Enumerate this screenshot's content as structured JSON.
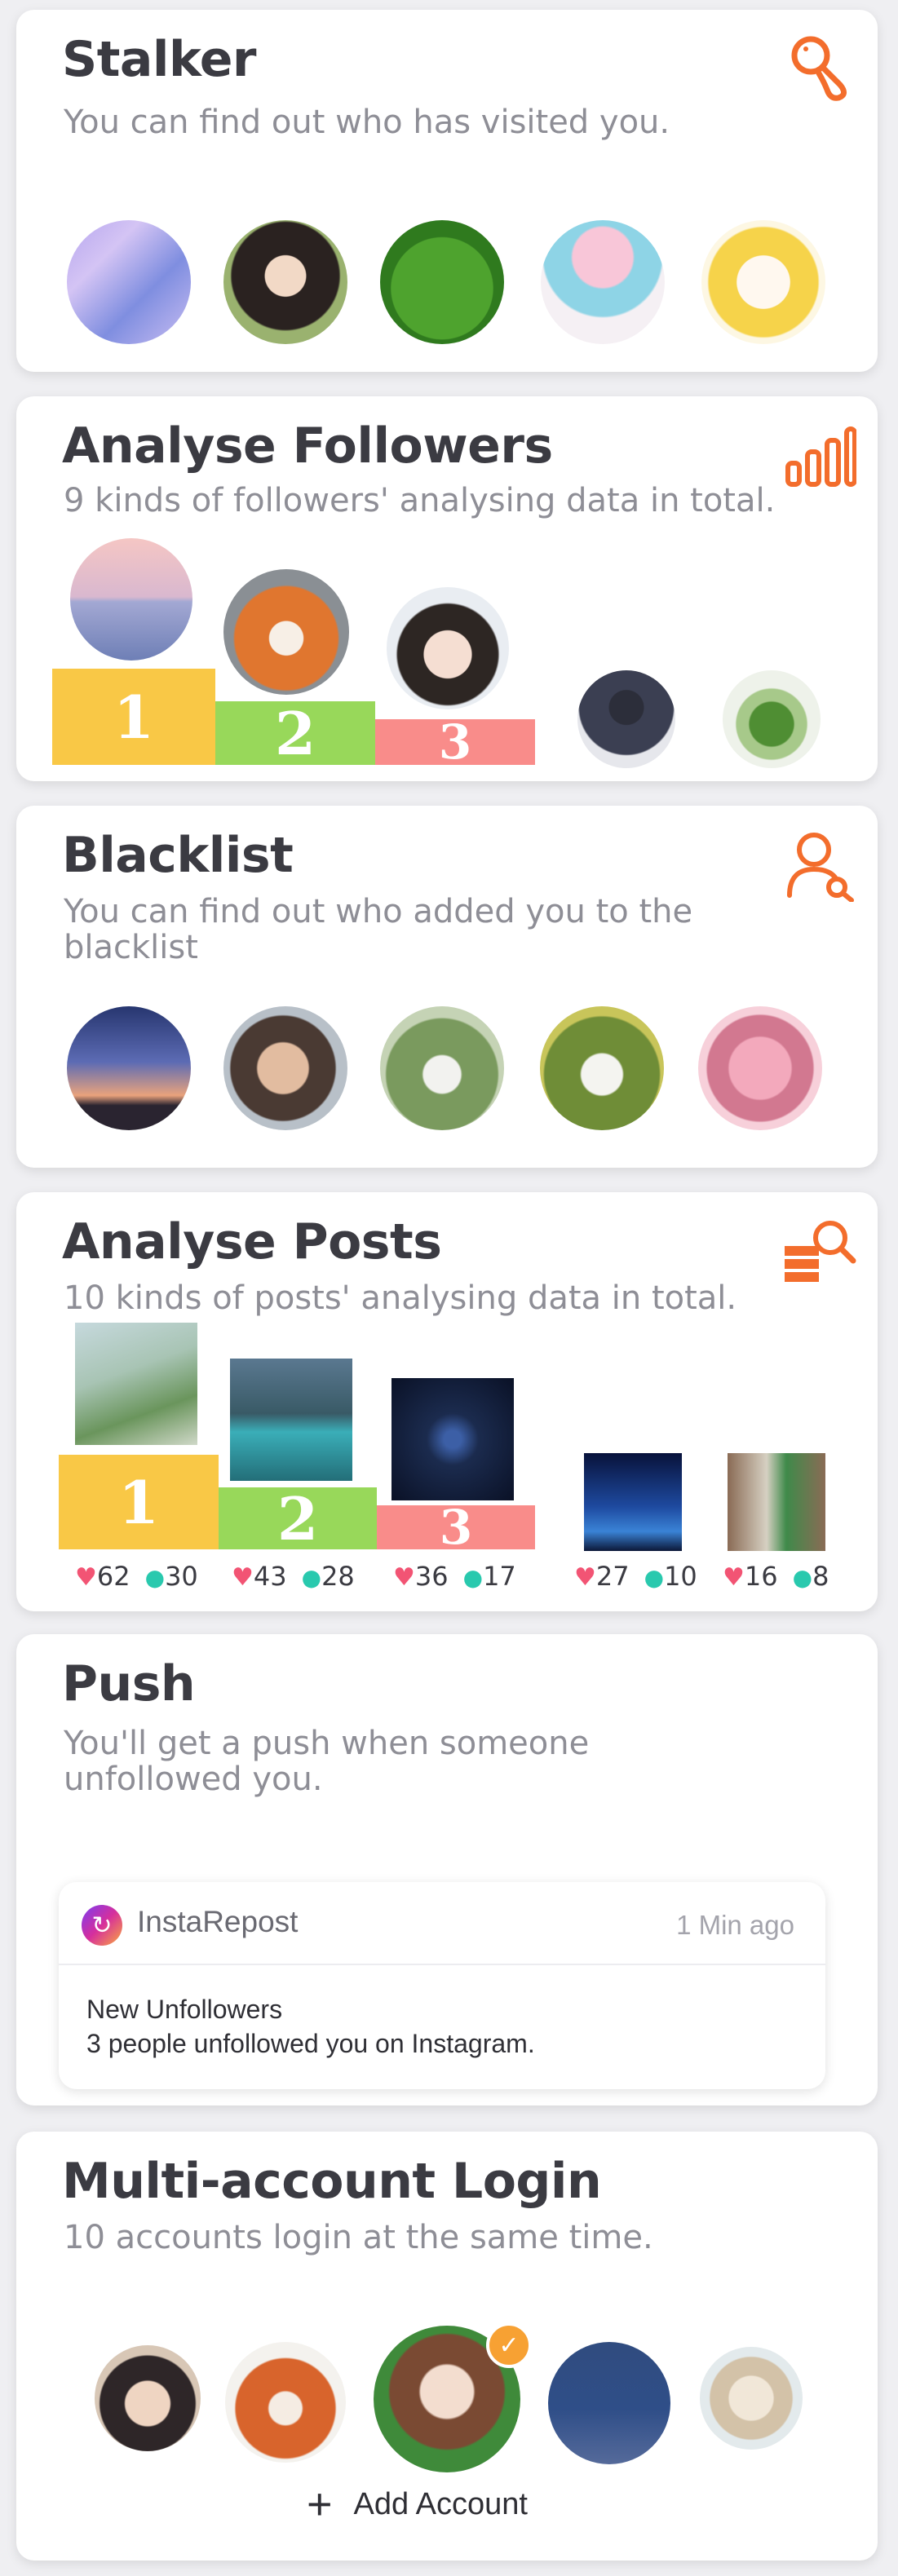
{
  "stalker": {
    "title": "Stalker",
    "subtitle": "You can find out who has visited you.",
    "icon": "footprint-search-icon"
  },
  "followers": {
    "title": "Analyse Followers",
    "subtitle": "9 kinds of followers' analysing data in total.",
    "icon": "bar-chart-icon",
    "ranks": [
      "1",
      "2",
      "3"
    ]
  },
  "blacklist": {
    "title": "Blacklist",
    "subtitle_line1": "You can find out who added you to the",
    "subtitle_line2": "blacklist",
    "icon": "user-search-icon"
  },
  "posts": {
    "title": "Analyse Posts",
    "subtitle": "10 kinds of posts' analysing data in total.",
    "icon": "stack-search-icon",
    "ranks": [
      "1",
      "2",
      "3"
    ],
    "stats": [
      {
        "likes": "62",
        "comments": "30"
      },
      {
        "likes": "43",
        "comments": "28"
      },
      {
        "likes": "36",
        "comments": "17"
      },
      {
        "likes": "27",
        "comments": "10"
      },
      {
        "likes": "16",
        "comments": "8"
      }
    ]
  },
  "push": {
    "title": "Push",
    "subtitle_line1": "You'll get a push when someone",
    "subtitle_line2": "unfollowed you.",
    "notification": {
      "app_name": "InstaRepost",
      "time": "1 Min ago",
      "heading": "New Unfollowers",
      "body": "3 people unfollowed you on Instagram."
    }
  },
  "multi": {
    "title": "Multi-account Login",
    "subtitle": "10 accounts login at the same time.",
    "add_label": "Add Account"
  },
  "colors": {
    "accent": "#f36d2c",
    "gold": "#f9c846",
    "green": "#98d85a",
    "coral": "#f98c8a",
    "heart": "#f25474",
    "comment": "#29c9ae"
  }
}
